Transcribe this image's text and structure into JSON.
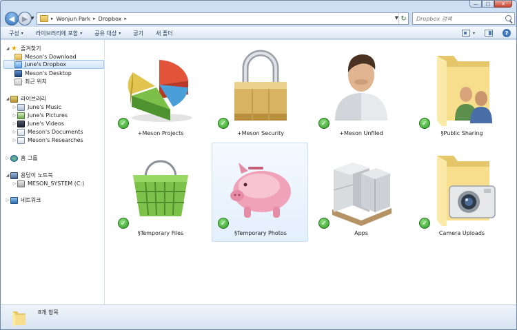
{
  "window": {
    "minimize_glyph": "—",
    "maximize_glyph": "□",
    "close_glyph": "✕"
  },
  "address": {
    "crumbs": [
      "Wonjun Park",
      "Dropbox"
    ],
    "separator": "▸"
  },
  "search": {
    "placeholder": "Dropbox 검색"
  },
  "toolbar": {
    "organize": "구성",
    "include_in_library": "라이브러리에 포함",
    "share_with": "공유 대상",
    "burn": "굽기",
    "new_folder": "새 폴더",
    "caret": "▾",
    "help": "?"
  },
  "nav": {
    "favorites": {
      "label": "즐겨찾기",
      "items": [
        "Meson's Download",
        "June's Dropbox",
        "Meson's Desktop",
        "최근 위치"
      ],
      "selected_index": 1
    },
    "libraries": {
      "label": "라이브러리",
      "items": [
        "June's Music",
        "June's Pictures",
        "June's Videos",
        "Meson's Documents",
        "Meson's Researches"
      ]
    },
    "homegroup": {
      "label": "홈 그룹"
    },
    "computer": {
      "label": "용답이 노트북",
      "items": [
        "MESON_SYSTEM (C:)"
      ]
    },
    "network": {
      "label": "네트워크"
    },
    "expand_glyph": "▷",
    "collapse_glyph": "◢"
  },
  "items": [
    {
      "label": "Meson Projects",
      "prefix": "+",
      "icon": "pie-chart-icon"
    },
    {
      "label": "Meson Security",
      "prefix": "+",
      "icon": "padlock-icon"
    },
    {
      "label": "Meson Unfiled",
      "prefix": "+",
      "icon": "user-icon"
    },
    {
      "label": "Public Sharing",
      "prefix": "§",
      "icon": "shared-folder-icon"
    },
    {
      "label": "Temporary Files",
      "prefix": "§",
      "icon": "basket-icon"
    },
    {
      "label": "Temporary Photos",
      "prefix": "§",
      "icon": "piggy-bank-icon"
    },
    {
      "label": "Apps",
      "prefix": "",
      "icon": "boxes-icon"
    },
    {
      "label": "Camera Uploads",
      "prefix": "",
      "icon": "camera-folder-icon"
    }
  ],
  "sync_glyph": "✓",
  "status": {
    "count_text": "8개 항목"
  },
  "colors": {
    "accent": "#3399ff",
    "sync_ok": "#2f9a27",
    "selection": "#d2e6fb"
  }
}
